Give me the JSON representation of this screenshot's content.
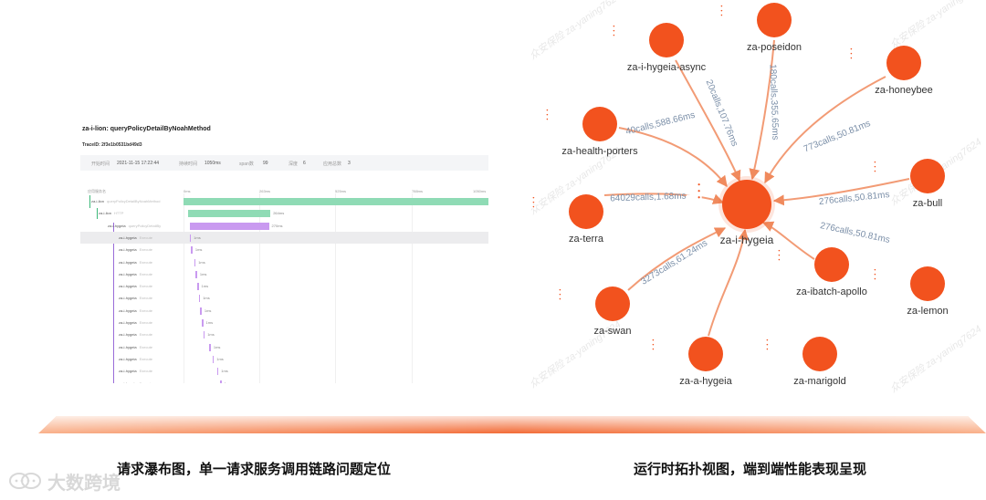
{
  "waterfall": {
    "title": "za-i-lion: queryPolicyDetailByNoahMethod",
    "trace_id": "TraceID: 2f3e1b0531bd49d3",
    "meta": [
      {
        "key": "开始时间",
        "value": "2021-11-15 17:22:44"
      },
      {
        "key": "持续时间",
        "value": "1050ms"
      },
      {
        "key": "span数",
        "value": "99"
      },
      {
        "key": "深度",
        "value": "6"
      },
      {
        "key": "应用总数",
        "value": "3"
      }
    ],
    "ruler_header": "应用服务名",
    "ruler_ticks": [
      "0ms",
      "263ms",
      "525ms",
      "788ms",
      "1050ms"
    ],
    "rows": [
      {
        "service": "za-i-lion",
        "op": "queryPolicyDetailByNoahMethod",
        "start": 0.0,
        "width": 1.0,
        "color": "#8fdbb5",
        "label": ""
      },
      {
        "service": "za-i-lion",
        "op": "HTTP",
        "start": 0.015,
        "width": 0.27,
        "color": "#8fdbb5",
        "label": "264ms"
      },
      {
        "service": "za-i-hygeia",
        "op": "queryPolicyDetailBy",
        "start": 0.02,
        "width": 0.26,
        "color": "#c99af0",
        "label": "270ms"
      },
      {
        "service": "za-i-hygeia",
        "op": "Execute",
        "start": 0.02,
        "width": 0.004,
        "color": "#c99af0",
        "label": "1ms"
      },
      {
        "service": "za-i-hygeia",
        "op": "Execute",
        "start": 0.025,
        "width": 0.004,
        "color": "#c99af0",
        "label": "1ms"
      },
      {
        "service": "za-i-hygeia",
        "op": "Execute",
        "start": 0.035,
        "width": 0.004,
        "color": "#c99af0",
        "label": "1ms"
      },
      {
        "service": "za-i-hygeia",
        "op": "Execute",
        "start": 0.04,
        "width": 0.004,
        "color": "#c99af0",
        "label": "1ms"
      },
      {
        "service": "za-i-hygeia",
        "op": "Execute",
        "start": 0.045,
        "width": 0.004,
        "color": "#c99af0",
        "label": "1ms"
      },
      {
        "service": "za-i-hygeia",
        "op": "Execute",
        "start": 0.05,
        "width": 0.004,
        "color": "#c99af0",
        "label": "1ms"
      },
      {
        "service": "za-i-hygeia",
        "op": "Execute",
        "start": 0.055,
        "width": 0.004,
        "color": "#c99af0",
        "label": "1ms"
      },
      {
        "service": "za-i-hygeia",
        "op": "Execute",
        "start": 0.06,
        "width": 0.004,
        "color": "#c99af0",
        "label": "1ms"
      },
      {
        "service": "za-i-hygeia",
        "op": "Execute",
        "start": 0.065,
        "width": 0.004,
        "color": "#c99af0",
        "label": "1ms"
      },
      {
        "service": "za-i-hygeia",
        "op": "Execute",
        "start": 0.085,
        "width": 0.004,
        "color": "#c99af0",
        "label": "1ms"
      },
      {
        "service": "za-i-hygeia",
        "op": "Execute",
        "start": 0.095,
        "width": 0.004,
        "color": "#c99af0",
        "label": "1ms"
      },
      {
        "service": "za-i-hygeia",
        "op": "Execute",
        "start": 0.11,
        "width": 0.004,
        "color": "#c99af0",
        "label": "1ms"
      },
      {
        "service": "za-i-hygeia",
        "op": "Execute",
        "start": 0.12,
        "width": 0.004,
        "color": "#c99af0",
        "label": "1ms"
      }
    ]
  },
  "topology": {
    "nodes": [
      {
        "id": "center",
        "label": "za-i-hygeia"
      },
      {
        "id": "poseidon",
        "label": "za-poseidon"
      },
      {
        "id": "hygeia_async",
        "label": "za-i-hygeia-async"
      },
      {
        "id": "honeybee",
        "label": "za-honeybee"
      },
      {
        "id": "health_porters",
        "label": "za-health-porters"
      },
      {
        "id": "bull",
        "label": "za-bull"
      },
      {
        "id": "terra",
        "label": "za-terra"
      },
      {
        "id": "ibatch_apollo",
        "label": "za-ibatch-apollo"
      },
      {
        "id": "lemon",
        "label": "za-lemon"
      },
      {
        "id": "swan",
        "label": "za-swan"
      },
      {
        "id": "a_hygeia",
        "label": "za-a-hygeia"
      },
      {
        "id": "marigold",
        "label": "za-marigold"
      }
    ],
    "edges": [
      {
        "from": "poseidon",
        "label": "180calls,355.65ms"
      },
      {
        "from": "hygeia_async",
        "label": "20calls,107.76ms"
      },
      {
        "from": "health_porters",
        "label": "40calls,588.66ms"
      },
      {
        "from": "honeybee",
        "label": "773calls,50.81ms"
      },
      {
        "from": "bull",
        "label": "276calls,50.81ms"
      },
      {
        "from": "terra",
        "label": "64029calls,1.68ms"
      },
      {
        "from": "ibatch_apollo",
        "label": "276calls,50.81ms"
      },
      {
        "from": "swan",
        "label": "3273calls,61.24ms"
      },
      {
        "from": "a_hygeia",
        "label": ""
      }
    ],
    "node_color": "#f2521e",
    "edge_color": "#f08a5d",
    "edge_label_color": "#7b8fa8",
    "watermark": "众安保险 za-yaning7624"
  },
  "captions": {
    "left": "请求瀑布图，单一请求服务调用链路问题定位",
    "right": "运行时拓扑视图，端到端性能表现呈现"
  },
  "logo": {
    "text": "大数跨境",
    "icon": "chat-bubbles-icon"
  }
}
